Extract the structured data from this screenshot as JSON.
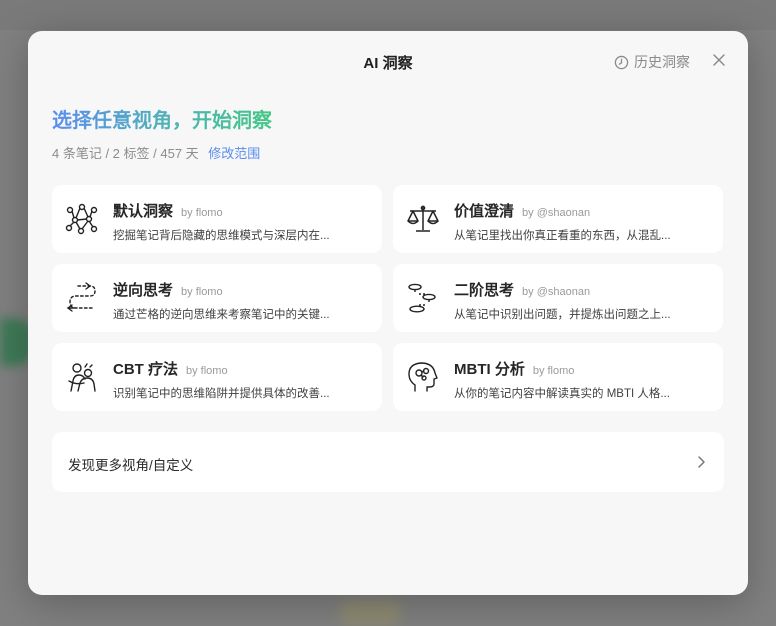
{
  "dialog": {
    "title": "AI 洞察",
    "history_label": "历史洞察",
    "headline": "选择任意视角，开始洞察",
    "stats": "4 条笔记 / 2 标签 / 457 天",
    "edit_scope": "修改范围"
  },
  "perspectives": [
    {
      "name": "默认洞察",
      "by": "by flomo",
      "desc": "挖掘笔记背后隐藏的思维模式与深层内在...",
      "icon": "network-icon"
    },
    {
      "name": "价值澄清",
      "by": "by @shaonan",
      "desc": "从笔记里找出你真正看重的东西，从混乱...",
      "icon": "scale-icon"
    },
    {
      "name": "逆向思考",
      "by": "by flomo",
      "desc": "通过芒格的逆向思维来考察笔记中的关键...",
      "icon": "reverse-path-icon"
    },
    {
      "name": "二阶思考",
      "by": "by @shaonan",
      "desc": "从笔记中识别出问题，并提炼出问题之上...",
      "icon": "stepping-stones-icon"
    },
    {
      "name": "CBT 疗法",
      "by": "by flomo",
      "desc": "识别笔记中的思维陷阱并提供具体的改善...",
      "icon": "hugging-people-icon"
    },
    {
      "name": "MBTI 分析",
      "by": "by flomo",
      "desc": "从你的笔记内容中解读真实的 MBTI 人格...",
      "icon": "head-mind-icon"
    }
  ],
  "more": {
    "label": "发现更多视角/自定义"
  }
}
